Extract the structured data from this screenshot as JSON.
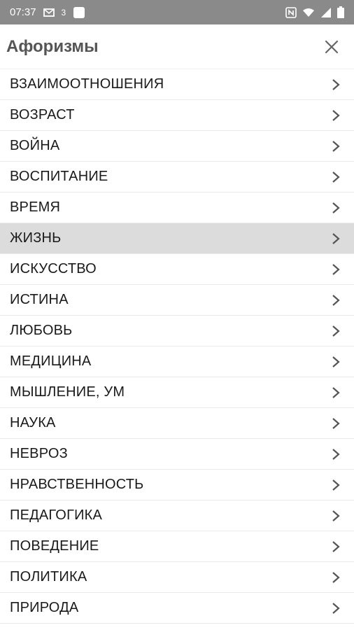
{
  "status_bar": {
    "time": "07:37",
    "indicator_text": "3"
  },
  "header": {
    "title": "Афоризмы"
  },
  "list": {
    "selected_index": 5,
    "items": [
      {
        "label": "ВЗАИМООТНОШЕНИЯ"
      },
      {
        "label": "ВОЗРАСТ"
      },
      {
        "label": "ВОЙНА"
      },
      {
        "label": "ВОСПИТАНИЕ"
      },
      {
        "label": "ВРЕМЯ"
      },
      {
        "label": "ЖИЗНЬ"
      },
      {
        "label": "ИСКУССТВО"
      },
      {
        "label": "ИСТИНА"
      },
      {
        "label": "ЛЮБОВЬ"
      },
      {
        "label": "МЕДИЦИНА"
      },
      {
        "label": "МЫШЛЕНИЕ, УМ"
      },
      {
        "label": "НАУКА"
      },
      {
        "label": "НЕВРОЗ"
      },
      {
        "label": "НРАВСТВЕННОСТЬ"
      },
      {
        "label": "ПЕДАГОГИКА"
      },
      {
        "label": "ПОВЕДЕНИЕ"
      },
      {
        "label": "ПОЛИТИКА"
      },
      {
        "label": "ПРИРОДА"
      }
    ]
  },
  "colors": {
    "status_bar_bg": "#8a8a8a",
    "selected_row_bg": "#dcdcdc",
    "title_color": "#555555"
  },
  "icons": {
    "close": "close-icon",
    "chevron": "chevron-right-icon"
  }
}
